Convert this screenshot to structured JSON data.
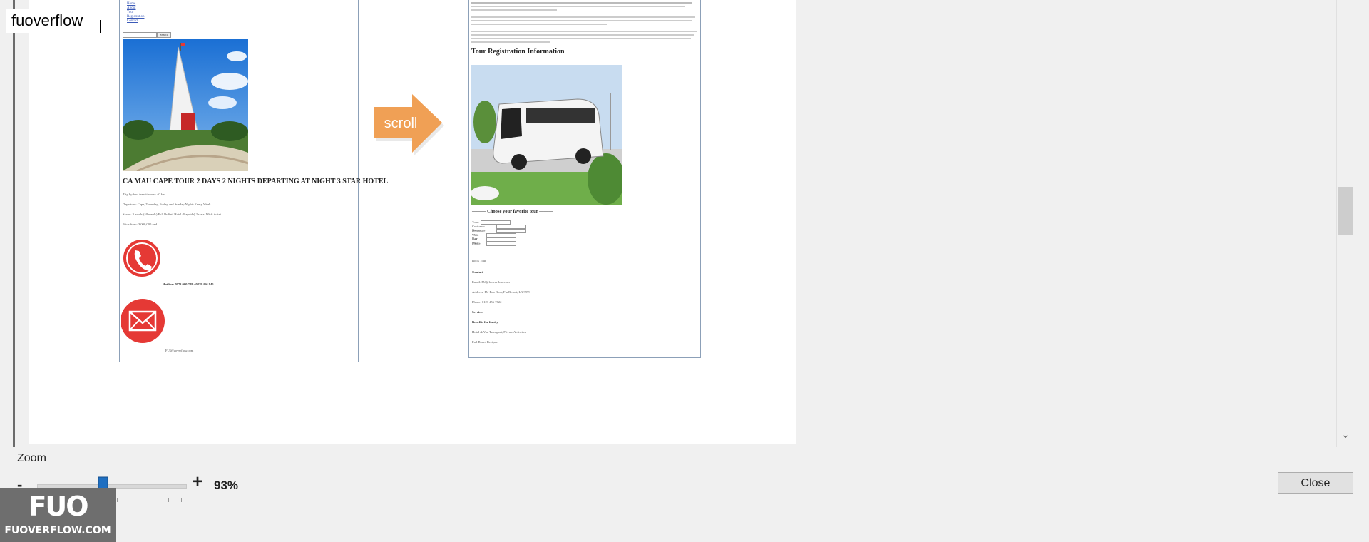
{
  "watermark": {
    "brand_text": "fuoverflow",
    "logo_mark": "FUO",
    "logo_url": "FUOVERFLOW.COM"
  },
  "preview": {
    "left_page": {
      "nav_links": [
        "Home",
        "About",
        "Tour",
        "Registration",
        "Contact"
      ],
      "search_button": "Search",
      "tour_title": "CA MAU CAPE TOUR 2 DAYS 2 NIGHTS DEPARTING AT NIGHT 3 STAR HOTEL",
      "details": [
        "Trip by bus, transit room: 40 km",
        "Departure: Cape, Thursday, Friday and Sunday Nights Every Week",
        "Saved: 3 meals (all meals) Full Buffet/ Hotel (Bayside) 2 stars/ Wi-fi ticket",
        "Price from: 3,000,000 vnd"
      ],
      "hotline": "Hotline: 0973 000 788 - 0839 456 945",
      "email": "FU@fuoverflow.com"
    },
    "arrow_label": "scroll",
    "right_page": {
      "section_title": "Tour Registration Information",
      "choose_heading": "——— Choose your favorite tour ———",
      "form_rows": [
        "Tour:",
        "Customer Name:",
        "Departure day:",
        "Total Day:",
        "Full Price:",
        "Phone:"
      ],
      "book_label": "Book Tour",
      "contact_title": "Contact",
      "contact_lines": [
        "Email: FU@fuoverflow.com",
        "Address: FU Bao Bien, FuoResort, LA 9999",
        "Phone: 0123 456 7822"
      ],
      "services_title": "Services",
      "benefits_title": "Benefits for family",
      "benefits_lines": [
        "Hotel & Van Transport, Private Activities",
        "Full Board Recipes"
      ]
    }
  },
  "zoom": {
    "label": "Zoom",
    "minus": "-",
    "plus": "+",
    "value": "93%",
    "level_fraction": 0.45
  },
  "buttons": {
    "close": "Close"
  },
  "colors": {
    "slider_thumb": "#1f6fc1",
    "arrow": "#f0a055",
    "phone_circle": "#e53935",
    "frame_border": "#8ca0b8"
  },
  "icons": {
    "phone": "phone-icon",
    "email": "envelope-icon",
    "arrow": "arrow-right-icon",
    "scroll_down": "chevron-down-icon"
  }
}
